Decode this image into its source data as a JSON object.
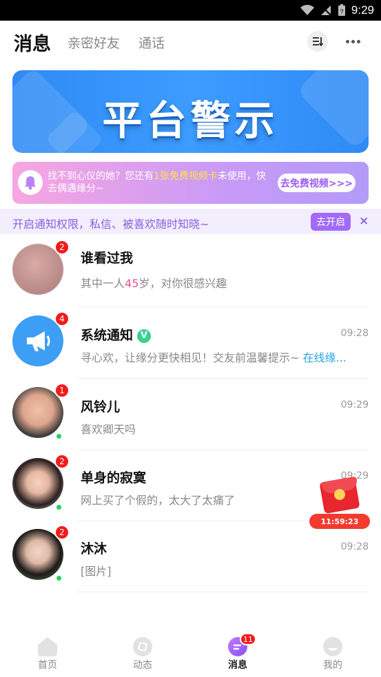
{
  "status_bar": {
    "time": "9:29"
  },
  "header": {
    "title": "消息",
    "tabs": [
      "亲密好友",
      "通话"
    ]
  },
  "banner": {
    "title": "平台警示"
  },
  "promo": {
    "text_before": "找不到心仪的她？您还有",
    "highlight": "1张免费视频卡",
    "text_after": "未使用，快去偶遇缘分~",
    "button": "去免费视频>>>"
  },
  "notice": {
    "text": "开启通知权限，私信、被喜欢随时知晓~",
    "button": "去开启",
    "close": "×"
  },
  "messages": [
    {
      "name": "谁看过我",
      "badge": "2",
      "time": "",
      "msg_before": "其中一人",
      "msg_highlight": "45",
      "msg_after": "岁，对你很感兴趣"
    },
    {
      "name": "系统通知",
      "verified": "V",
      "badge": "4",
      "time": "09:28",
      "msg": "寻心欢，让缘分更快相见！交友前温馨提示~ ",
      "msg_link": "在线缘..."
    },
    {
      "name": "风铃儿",
      "badge": "1",
      "time": "09:29",
      "msg": "喜欢卿天吗"
    },
    {
      "name": "单身的寂寞",
      "badge": "2",
      "time": "09:29",
      "msg": "网上买了个假的，太大了太痛了"
    },
    {
      "name": "沐沐",
      "badge": "2",
      "time": "09:28",
      "msg": "[图片]"
    }
  ],
  "red_packet": {
    "timer": "11:59:23"
  },
  "tabbar": {
    "items": [
      {
        "label": "首页",
        "icon": "home-icon"
      },
      {
        "label": "动态",
        "icon": "moments-icon"
      },
      {
        "label": "消息",
        "icon": "message-icon",
        "badge": "11"
      },
      {
        "label": "我的",
        "icon": "profile-icon"
      }
    ]
  },
  "colors": {
    "accent": "#a26bf5",
    "badge": "#f21b1b",
    "online": "#21d35a",
    "link": "#28a3e6"
  }
}
